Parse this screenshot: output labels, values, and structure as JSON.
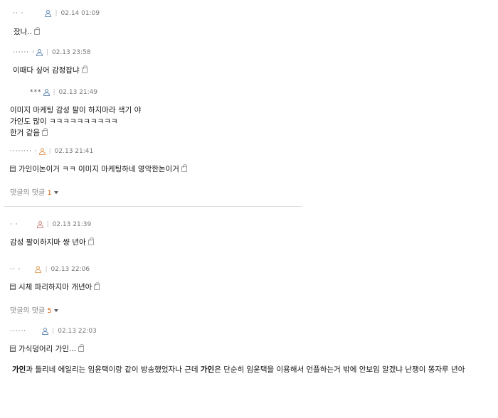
{
  "comments": [
    {
      "nick": "·· ·",
      "date": "02.14 01:09",
      "text": "잤나..",
      "icon": "blue"
    },
    {
      "nick": "······ ·",
      "date": "02.13 23:58",
      "text": "이때다 싶어 감정잡냐",
      "icon": "blue"
    },
    {
      "nick": "***",
      "date": "02.13 21:49",
      "lines": [
        "이미지 마케팅 감성 팔이 하지마라 색기 야",
        "가인도 많이 ㅋㅋㅋㅋㅋㅋㅋㅋㅋㅋ",
        "한거 같음"
      ],
      "icon": "blue"
    },
    {
      "nick": "········ ·",
      "date": "02.13 21:41",
      "text": "가인이논이거 ㅋㅋ 이미지 마케팅하네 영악한논이거",
      "icon": "orange",
      "doc": true
    },
    {
      "nick": "·  ·",
      "date": "02.13 21:39",
      "text": "감성 팔이하지마 썅 년아",
      "icon": "red"
    },
    {
      "nick": "··  ·",
      "date": "02.13 22:06",
      "text": "시체 파리하지마 개년아",
      "icon": "orange",
      "doc": true
    },
    {
      "nick": "······",
      "date": "02.13 22:03",
      "text": "가식덩어리 가인...",
      "icon": "blue",
      "doc": true
    }
  ],
  "replies": [
    {
      "label": "댓글의 댓글",
      "count": "1"
    },
    {
      "label": "댓글의 댓글",
      "count": "5"
    }
  ],
  "article": {
    "p1": "가인",
    "p2": "과 들리네 에일리는 임윤택이랑 같이 방송했었자나 근데 ",
    "p3": "가인",
    "p4": "은 단순히 임윤택을 이용해서 언플하는거 밖에 안보임 알겠냐 난쟁이 똥자루 년아"
  }
}
